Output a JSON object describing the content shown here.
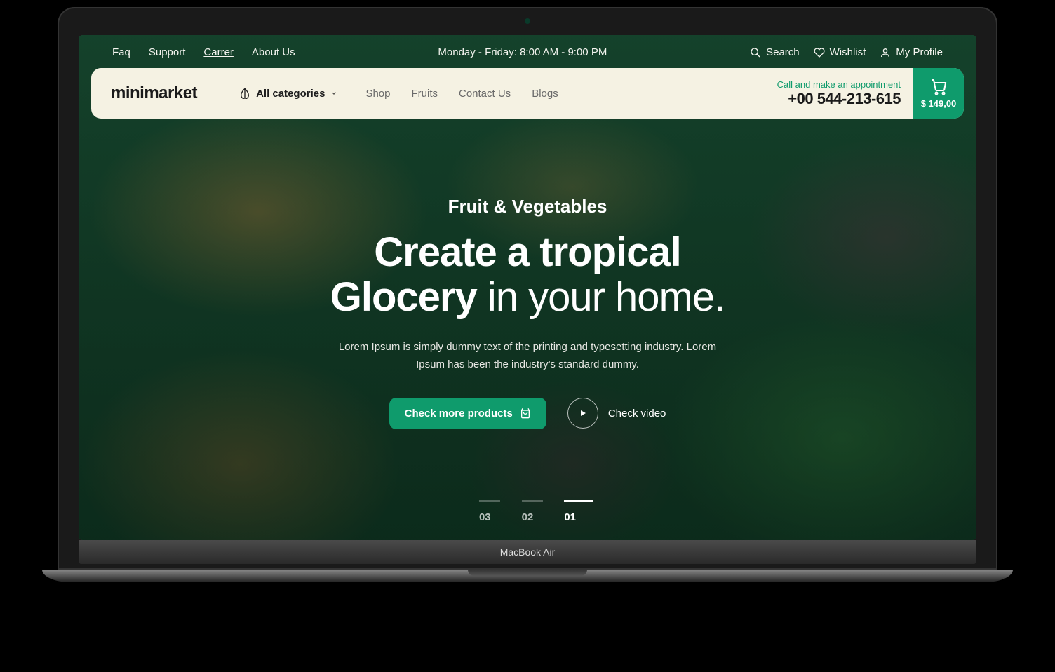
{
  "device": {
    "label": "MacBook Air"
  },
  "topbar": {
    "left": [
      {
        "label": "Faq"
      },
      {
        "label": "Support"
      },
      {
        "label": "Carrer",
        "active": true
      },
      {
        "label": "About Us"
      }
    ],
    "hours": "Monday - Friday:  8:00 AM - 9:00 PM",
    "right": {
      "search": "Search",
      "wishlist": "Wishlist",
      "profile": "My Profile"
    }
  },
  "navbar": {
    "logo": "minimarket",
    "all_categories": "All categories",
    "links": [
      "Shop",
      "Fruits",
      "Contact Us",
      "Blogs"
    ],
    "call_label": "Call and make an appointment",
    "phone": "+00 544-213-615",
    "cart_price": "$ 149,00"
  },
  "hero": {
    "subtitle": "Fruit & Vegetables",
    "title_bold_1": "Create a tropical",
    "title_bold_2": "Glocery",
    "title_light": " in your home.",
    "desc": "Lorem Ipsum is simply dummy text of the printing and typesetting industry. Lorem Ipsum has been the industry's standard dummy.",
    "cta": "Check more products",
    "video": "Check video"
  },
  "pagination": [
    "03",
    "02",
    "01"
  ]
}
